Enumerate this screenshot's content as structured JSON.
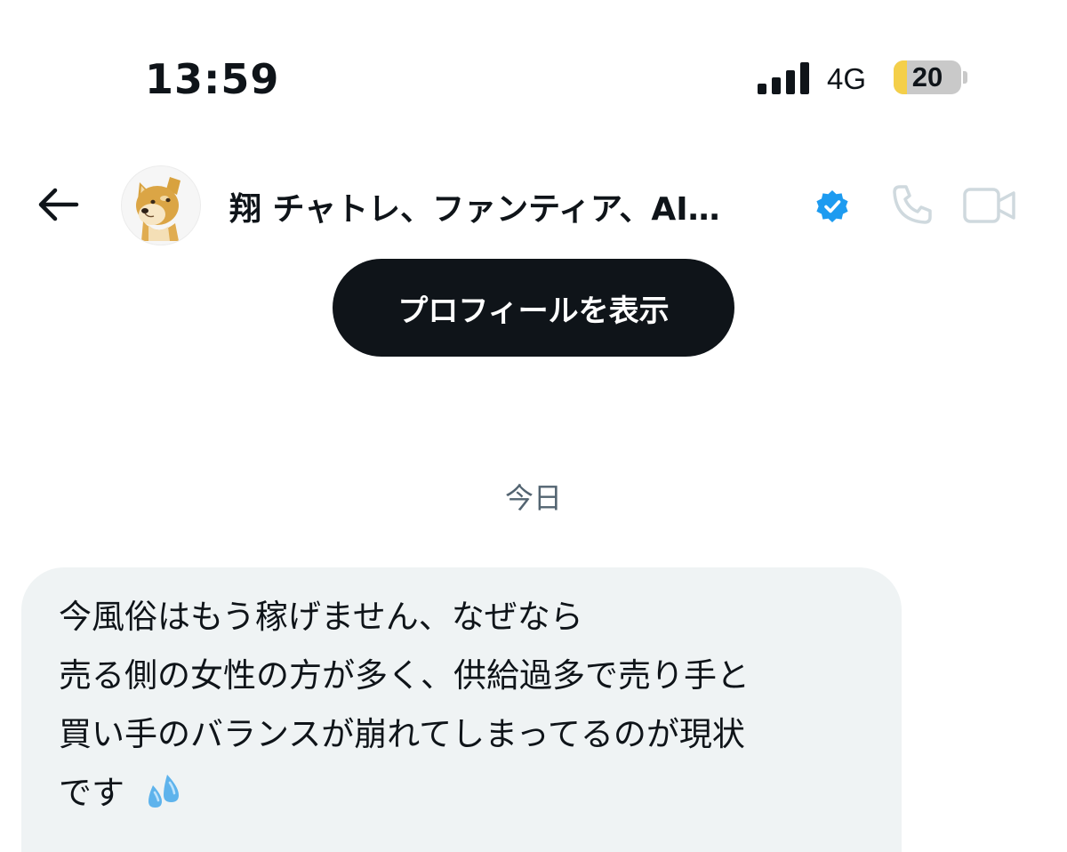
{
  "status_bar": {
    "time": "13:59",
    "network": "4G",
    "battery_level": "20",
    "battery_fraction": 0.2
  },
  "header": {
    "back_icon": "arrow-left-icon",
    "avatar_icon": "shiba-dog-avatar",
    "contact_name": "翔 チャトレ、ファンティア、AI…",
    "verified_icon": "verified-badge-icon",
    "verified_color": "#1d9bf0",
    "call_icon": "phone-icon",
    "video_icon": "video-camera-icon"
  },
  "profile_button": {
    "label": "プロフィールを表示"
  },
  "conversation": {
    "date_separator": "今日",
    "messages": [
      {
        "lines": [
          "今風俗はもう稼げません、なぜなら",
          "売る側の女性の方が多く、供給過多で売り手と",
          "買い手のバランスが崩れてしまってるのが現状",
          "です"
        ],
        "trailing_emoji": "sweat-droplets-icon"
      }
    ]
  },
  "colors": {
    "text": "#0f1419",
    "secondary_text": "#536471",
    "button_bg": "#0f1419",
    "bubble_bg": "#eff3f4",
    "battery": "#f4cf49",
    "disabled_icon": "#cfd9de"
  }
}
